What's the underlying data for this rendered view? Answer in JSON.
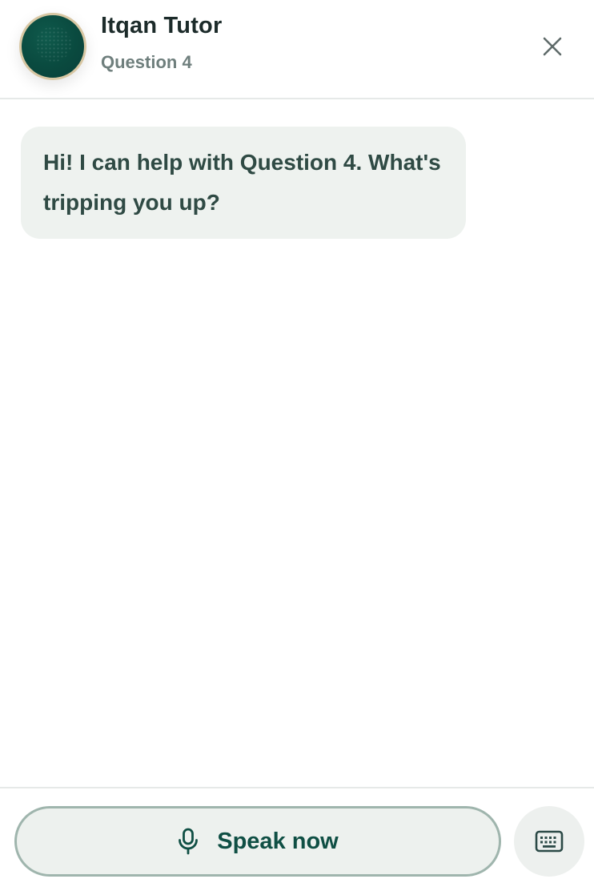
{
  "header": {
    "title": "Itqan Tutor",
    "subtitle": "Question 4",
    "close_icon": "close-icon"
  },
  "messages": [
    {
      "sender": "tutor",
      "text": "Hi! I can help with Question 4. What's tripping you up?"
    }
  ],
  "footer": {
    "speak_label": "Speak now",
    "mic_icon": "microphone-icon",
    "keyboard_icon": "keyboard-icon"
  },
  "colors": {
    "brand_dark_green": "#0a4a3f",
    "avatar_ring": "#d8c7a3",
    "bubble_bg": "#eef2ef",
    "bubble_text": "#2f4a44",
    "speak_border": "#9fb5ad",
    "speak_text": "#0f4f44"
  }
}
